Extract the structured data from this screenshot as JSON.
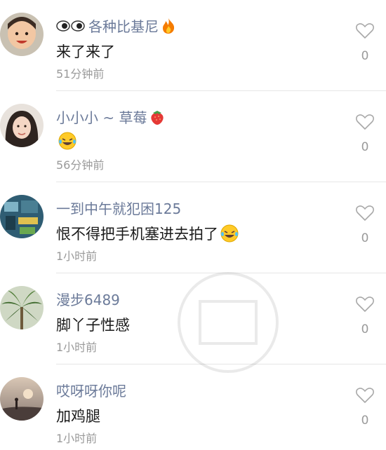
{
  "comments": [
    {
      "name": "各种比基尼",
      "name_icons": [
        "eyes-icon",
        "fire-icon"
      ],
      "text": "来了来了",
      "text_icons": [],
      "time": "51分钟前",
      "likes": "0",
      "avatar": "baby-avatar"
    },
    {
      "name": "小小小 ~ 草莓",
      "name_icons": [
        "strawberry-icon"
      ],
      "text": "",
      "text_icons": [
        "laughing-emoji-icon"
      ],
      "time": "56分钟前",
      "likes": "0",
      "avatar": "girl-avatar"
    },
    {
      "name": "一到中午就犯困125",
      "name_icons": [],
      "text": "恨不得把手机塞进去拍了",
      "text_icons": [
        "laughing-emoji-icon"
      ],
      "time": "1小时前",
      "likes": "0",
      "avatar": "room-avatar"
    },
    {
      "name": "漫步6489",
      "name_icons": [],
      "text": "脚丫子性感",
      "text_icons": [],
      "time": "1小时前",
      "likes": "0",
      "avatar": "palm-avatar"
    },
    {
      "name": "哎呀呀你呢",
      "name_icons": [],
      "text": "加鸡腿",
      "text_icons": [],
      "time": "1小时前",
      "likes": "0",
      "avatar": "sunset-avatar"
    }
  ],
  "colors": {
    "name": "#6b7a99",
    "text": "#1a1a1a",
    "meta": "#9a9a9a",
    "divider": "#e6e6e6"
  }
}
